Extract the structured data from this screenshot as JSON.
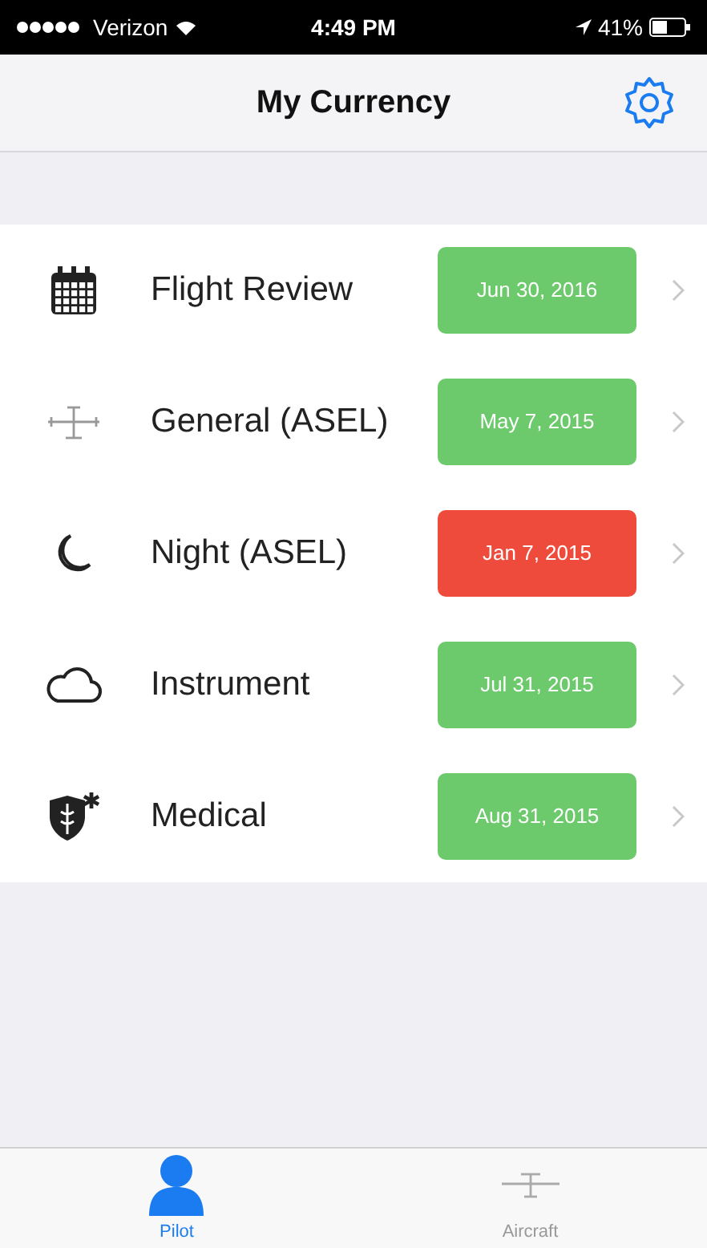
{
  "status_bar": {
    "carrier": "Verizon",
    "time": "4:49 PM",
    "battery": "41%"
  },
  "nav_bar": {
    "title": "My Currency"
  },
  "items": [
    {
      "label": "Flight Review",
      "date": "Jun 30, 2016",
      "expired": false
    },
    {
      "label": "General (ASEL)",
      "date": "May 7, 2015",
      "expired": false
    },
    {
      "label": "Night (ASEL)",
      "date": "Jan 7, 2015",
      "expired": true
    },
    {
      "label": "Instrument",
      "date": "Jul 31, 2015",
      "expired": false
    },
    {
      "label": "Medical",
      "date": "Aug 31, 2015",
      "expired": false
    }
  ],
  "tab_bar": [
    {
      "label": "Pilot",
      "selected": true
    },
    {
      "label": "Aircraft",
      "selected": false
    }
  ]
}
